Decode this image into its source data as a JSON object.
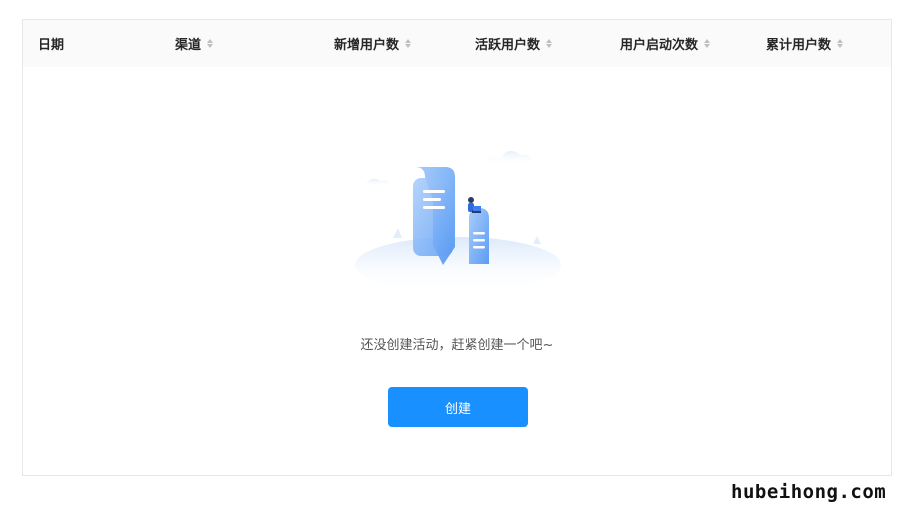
{
  "table": {
    "columns": [
      {
        "label": "日期",
        "sortable": false
      },
      {
        "label": "渠道",
        "sortable": true
      },
      {
        "label": "新增用户数",
        "sortable": true
      },
      {
        "label": "活跃用户数",
        "sortable": true
      },
      {
        "label": "用户启动次数",
        "sortable": true
      },
      {
        "label": "累计用户数",
        "sortable": true
      }
    ]
  },
  "empty": {
    "message": "还没创建活动，赶紧创建一个吧~",
    "illustration": "empty-documents-illustration"
  },
  "create_button": {
    "label": "创建"
  },
  "watermark": {
    "text": "hubeihong.com"
  },
  "colors": {
    "primary": "#1890ff",
    "header_bg": "#fafafa",
    "border": "#e8e8e8"
  }
}
